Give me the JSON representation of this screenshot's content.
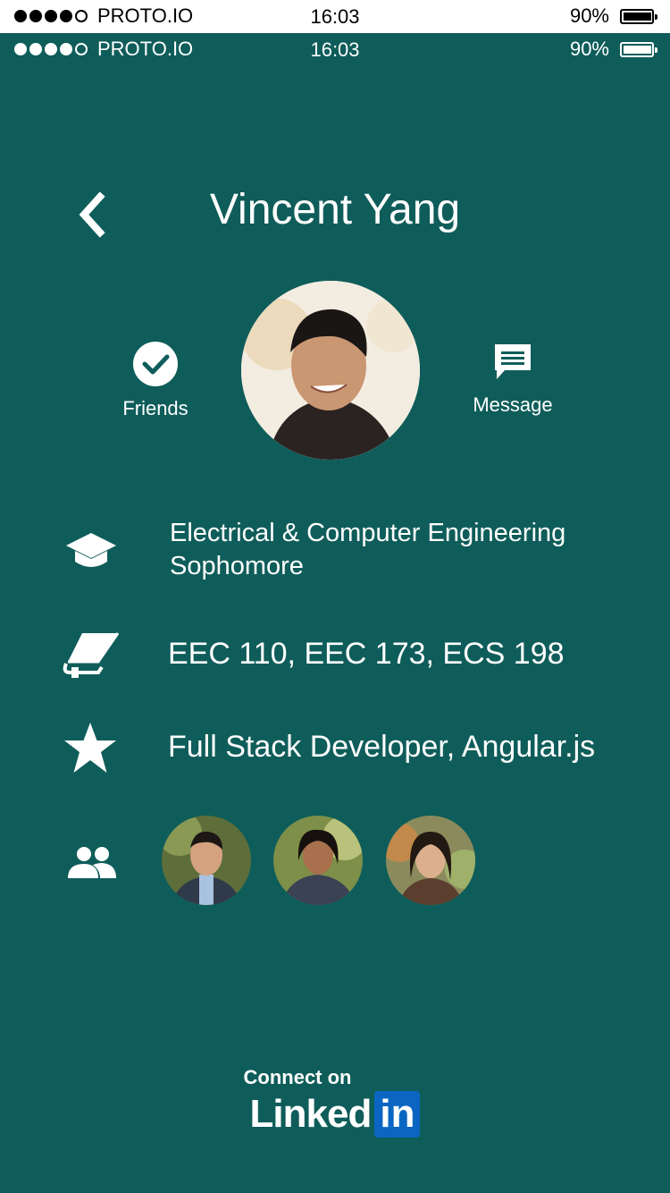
{
  "status_bar_outer": {
    "carrier": "PROTO.IO",
    "time": "16:03",
    "battery": "90%",
    "battery_level": 0.9
  },
  "status_bar_inner": {
    "carrier": "PROTO.IO",
    "time": "16:03",
    "battery": "90%",
    "battery_level": 0.9
  },
  "header": {
    "title": "Vincent Yang",
    "back_icon": "chevron-left-icon"
  },
  "actions": {
    "friends": {
      "label": "Friends",
      "icon": "check-circle-icon"
    },
    "message": {
      "label": "Message",
      "icon": "chat-bubble-icon"
    }
  },
  "profile": {
    "major": "Electrical & Computer Engineering",
    "year": "Sophomore",
    "courses": "EEC 110, EEC 173, ECS 198",
    "skills": "Full Stack Developer, Angular.js"
  },
  "mutual_friends_icon": "people-icon",
  "linkedin": {
    "small": "Connect on",
    "word": "Linked",
    "box": "in"
  },
  "colors": {
    "background": "#0f5d5a",
    "linkedin_blue": "#0a66c2"
  }
}
